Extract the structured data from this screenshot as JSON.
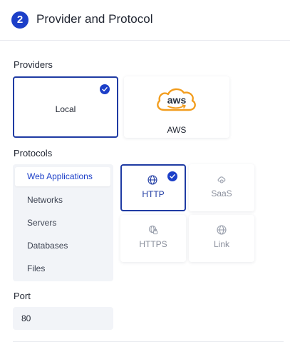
{
  "header": {
    "step_number": "2",
    "title": "Provider and Protocol"
  },
  "providers": {
    "label": "Providers",
    "items": [
      {
        "name": "Local",
        "selected": true
      },
      {
        "name": "AWS",
        "logo_text": "aws",
        "selected": false
      }
    ]
  },
  "protocols": {
    "label": "Protocols",
    "categories": [
      "Web Applications",
      "Networks",
      "Servers",
      "Databases",
      "Files"
    ],
    "active_category": "Web Applications",
    "cards": [
      {
        "name": "HTTP",
        "icon": "globe-icon",
        "selected": true
      },
      {
        "name": "SaaS",
        "icon": "cloud-gear-icon",
        "selected": false
      },
      {
        "name": "HTTPS",
        "icon": "globe-lock-icon",
        "selected": false
      },
      {
        "name": "Link",
        "icon": "globe-icon",
        "selected": false
      }
    ]
  },
  "port": {
    "label": "Port",
    "value": "80"
  },
  "colors": {
    "accent": "#1c3fc8",
    "aws_orange": "#f29d1e",
    "panel_bg": "#f2f4f8"
  }
}
